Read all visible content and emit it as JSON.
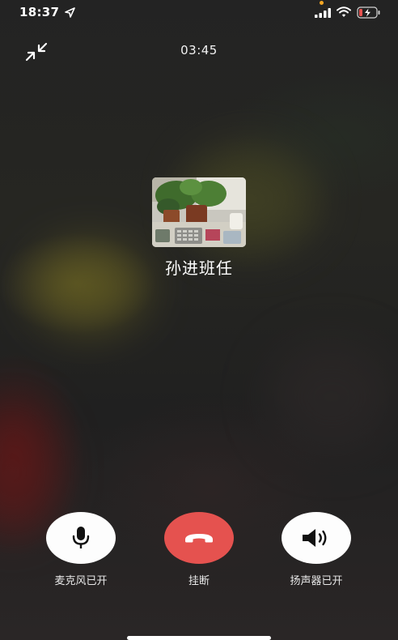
{
  "status_bar": {
    "time": "18:37",
    "icons": [
      "location-arrow-icon",
      "signal-icon",
      "wifi-icon",
      "battery-charging-icon"
    ]
  },
  "call": {
    "duration": "03:45",
    "contact_name": "孙进班任",
    "avatar": "contact-photo"
  },
  "controls": [
    {
      "icon": "microphone-icon",
      "label": "麦克风已开"
    },
    {
      "icon": "phone-hangup-icon",
      "label": "挂断",
      "color": "#e5524f"
    },
    {
      "icon": "speaker-icon",
      "label": "扬声器已开"
    }
  ],
  "colors": {
    "hangup": "#e5524f",
    "button_bg": "#fdfdfd",
    "indicator_dot": "#f5a623"
  }
}
